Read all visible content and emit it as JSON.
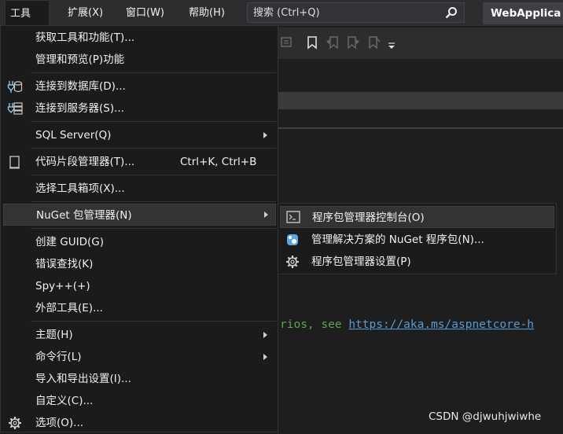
{
  "menubar": {
    "items": [
      "工具(T)",
      "扩展(X)",
      "窗口(W)",
      "帮助(H)"
    ],
    "search_placeholder": "搜索 (Ctrl+Q)",
    "window_title": "WebApplica"
  },
  "tools_menu": {
    "items": [
      {
        "label": "获取工具和功能(T)...",
        "icon": "none"
      },
      {
        "label": "管理和预览(P)功能",
        "icon": "none"
      },
      {
        "label": "连接到数据库(D)...",
        "icon": "database-connect-icon"
      },
      {
        "label": "连接到服务器(S)...",
        "icon": "server-connect-icon"
      },
      {
        "label": "SQL Server(Q)",
        "icon": "none",
        "submenu": true
      },
      {
        "label": "代码片段管理器(T)...",
        "icon": "snippet-icon",
        "shortcut": "Ctrl+K, Ctrl+B"
      },
      {
        "label": "选择工具箱项(X)...",
        "icon": "none"
      },
      {
        "label": "NuGet 包管理器(N)",
        "icon": "none",
        "submenu": true,
        "highlighted": true
      },
      {
        "label": "创建 GUID(G)",
        "icon": "none"
      },
      {
        "label": "错误查找(K)",
        "icon": "none"
      },
      {
        "label": "Spy++(+)",
        "icon": "none"
      },
      {
        "label": "外部工具(E)...",
        "icon": "none"
      },
      {
        "label": "主题(H)",
        "icon": "none",
        "submenu": true
      },
      {
        "label": "命令行(L)",
        "icon": "none",
        "submenu": true
      },
      {
        "label": "导入和导出设置(I)...",
        "icon": "none"
      },
      {
        "label": "自定义(C)...",
        "icon": "none"
      },
      {
        "label": "选项(O)...",
        "icon": "gear-icon"
      }
    ]
  },
  "nuget_submenu": {
    "items": [
      {
        "label": "程序包管理器控制台(O)",
        "icon": "console-icon",
        "highlighted": true
      },
      {
        "label": "管理解决方案的 NuGet 程序包(N)...",
        "icon": "nuget-icon"
      },
      {
        "label": "程序包管理器设置(P)",
        "icon": "gear-icon"
      }
    ]
  },
  "editor": {
    "code_comment": "rios, see ",
    "code_link": "https://aka.ms/aspnetcore-h"
  },
  "watermark": "CSDN @djwuhjwiwhe",
  "colors": {
    "menu_bg": "#1b1b1c",
    "highlight_bg": "#333334",
    "menubar_bg": "#2d2d30",
    "comment_green": "#57a64a",
    "link_blue": "#569cd6"
  }
}
